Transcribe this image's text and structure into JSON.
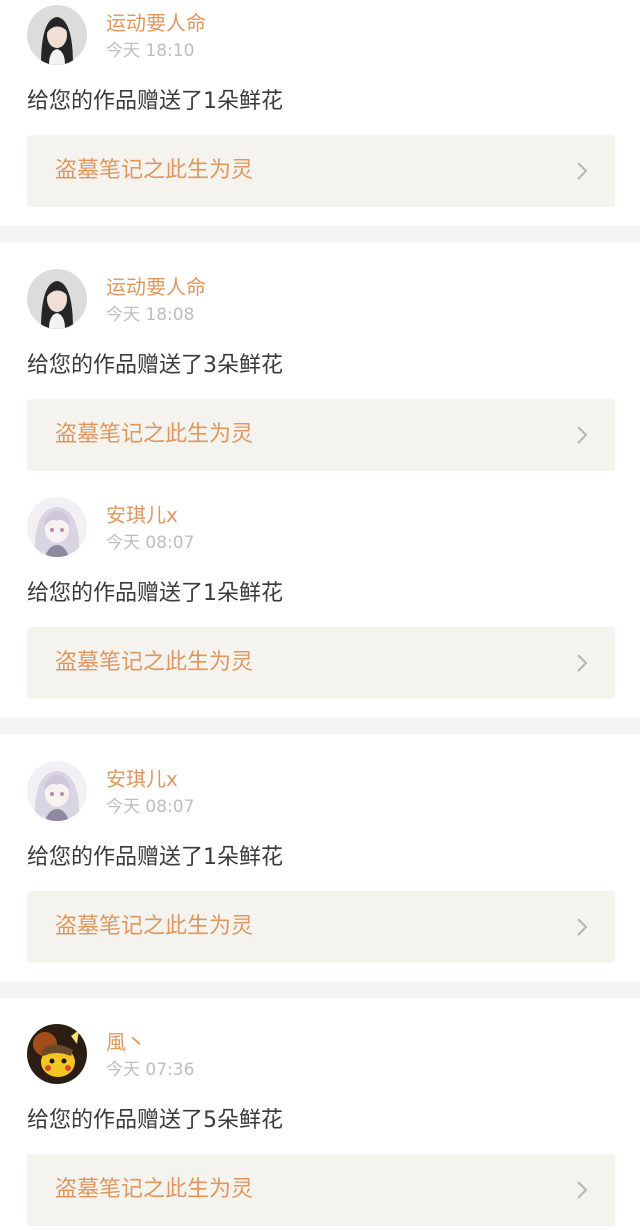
{
  "items": [
    {
      "username": "运动要人命",
      "time": "今天 18:10",
      "message": "给您的作品赠送了1朵鲜花",
      "work_title": "盗墓笔记之此生为灵",
      "avatar_icon": "portrait-woman-dark-hair"
    },
    {
      "username": "运动要人命",
      "time": "今天 18:08",
      "message": "给您的作品赠送了3朵鲜花",
      "work_title": "盗墓笔记之此生为灵",
      "avatar_icon": "portrait-woman-dark-hair"
    },
    {
      "username": "安琪儿x",
      "time": "今天 08:07",
      "message": "给您的作品赠送了1朵鲜花",
      "work_title": "盗墓笔记之此生为灵",
      "avatar_icon": "anime-girl-silver-hair"
    },
    {
      "username": "安琪儿x",
      "time": "今天 08:07",
      "message": "给您的作品赠送了1朵鲜花",
      "work_title": "盗墓笔记之此生为灵",
      "avatar_icon": "anime-girl-silver-hair"
    },
    {
      "username": "風丶",
      "time": "今天 07:36",
      "message": "给您的作品赠送了5朵鲜花",
      "work_title": "盗墓笔记之此生为灵",
      "avatar_icon": "pikachu-detective"
    }
  ],
  "colors": {
    "accent": "#e0975f",
    "card_bg": "#f4f3ee",
    "separator": "#f5f5f5",
    "text": "#3a3a3a",
    "time": "#bdbdbd"
  }
}
